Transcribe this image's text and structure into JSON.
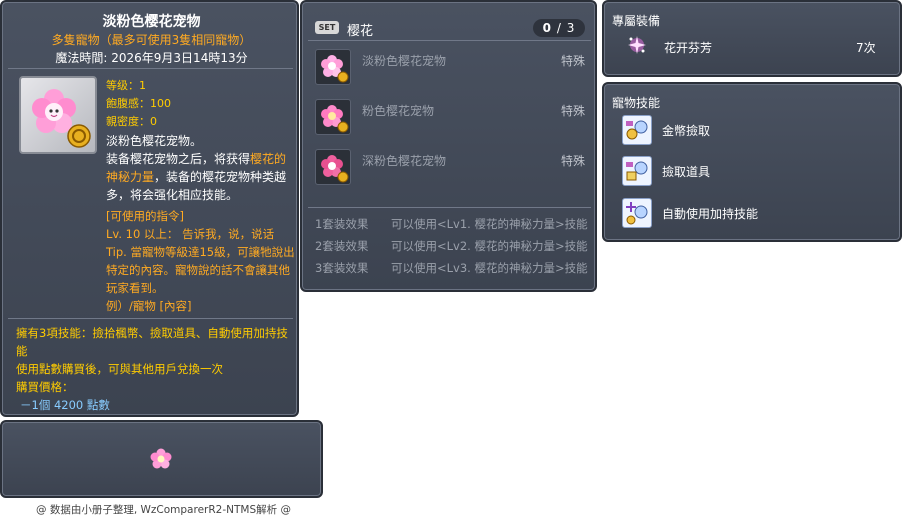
{
  "item_id": "05002127",
  "main": {
    "title": "淡粉色樱花宠物",
    "subtitle": "多隻寵物（最多可使用3隻相同寵物）",
    "magic_time": "魔法時間: 2026年9月3日14時13分",
    "stats": {
      "level": "等级：1",
      "fullness": "飽腹感：100",
      "closeness": "親密度：0"
    },
    "desc_line1": "淡粉色樱花宠物。",
    "desc_part_a": "装备樱花宠物之后，将获得",
    "desc_hl1": "樱花的神秘力量",
    "desc_part_b": "，装备的樱花宠物种类越多，将会强化相应技能。",
    "commands_title": "[可使用的指令]",
    "commands_body": "Lv. 10 以上：  告诉我，说，说话 Tip. 當寵物等級達15級，可讓牠說出特定的內容。寵物說的話不會讓其他玩家看到。",
    "commands_example": "例）/寵物 [內容]",
    "skills_line": "擁有3項技能：撿拾楓幣、撿取道具、自動使用加持技能",
    "exchange_line": "使用點數購買後，可與其他用戶兌換一次",
    "price_label": "購買價格：",
    "price_value": "－1個 4200 點數"
  },
  "credit": "@ 数据由小册子整理, WzComparerR2-NTMS解析 @",
  "set_panel": {
    "badge": "SET",
    "name": "樱花",
    "count_current": "0",
    "count_sep": "/",
    "count_total": "3",
    "items": [
      {
        "name": "淡粉色樱花宠物",
        "type": "特殊",
        "icon": "pale-pink-sakura-pet-icon"
      },
      {
        "name": "粉色樱花宠物",
        "type": "特殊",
        "icon": "pink-sakura-pet-icon"
      },
      {
        "name": "深粉色樱花宠物",
        "type": "特殊",
        "icon": "deep-pink-sakura-pet-icon"
      }
    ],
    "effects": [
      {
        "label": "1套装效果",
        "text": "可以使用<Lv1. 樱花的神秘力量>技能"
      },
      {
        "label": "2套装效果",
        "text": "可以使用<Lv2. 樱花的神秘力量>技能"
      },
      {
        "label": "3套装效果",
        "text": "可以使用<Lv3. 樱花的神秘力量>技能"
      }
    ]
  },
  "exclusive_panel": {
    "title": "專屬裝備",
    "item_name": "花开芬芳",
    "item_count": "7次"
  },
  "skills_panel": {
    "title": "寵物技能",
    "skills": [
      {
        "name": "金幣撿取"
      },
      {
        "name": "撿取道具"
      },
      {
        "name": "自動使用加持技能"
      }
    ]
  },
  "colors": {
    "panel_bg": "#434a57",
    "highlight_orange": "#ffaa22",
    "stat_yellow": "#ffcc00",
    "price_blue": "#88ccff"
  }
}
